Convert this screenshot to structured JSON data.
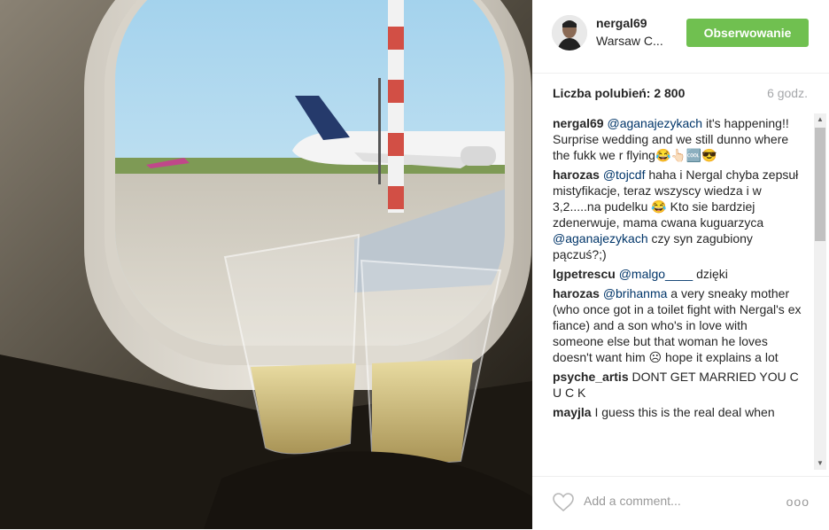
{
  "header": {
    "username": "nergal69",
    "location": "Warsaw C...",
    "follow_label": "Obserwowanie"
  },
  "stats": {
    "likes": "Liczba polubień: 2 800",
    "time": "6 godz."
  },
  "comments": [
    {
      "user": "nergal69",
      "mention": "@aganajezykach",
      "text": " it's happening!! Surprise wedding and we still dunno where the fukk we r flying😂👆🏻🆒😎"
    },
    {
      "user": "harozas",
      "mention": "@tojcdf",
      "text": " haha i Nergal chyba zepsuł mistyfikacje, teraz wszyscy wiedza i w 3,2.....na pudelku 😂 Kto sie bardziej zdenerwuje, mama cwana kuguarzyca ",
      "mention2": "@aganajezykach",
      "text2": " czy syn zagubiony pączuś?;)"
    },
    {
      "user": "lgpetrescu",
      "mention": "@malgo____",
      "text": " dzięki"
    },
    {
      "user": "harozas",
      "mention": "@brihanma",
      "text": " a very sneaky mother (who once got in a toilet fight with Nergal's ex fiance) and a son who's in love with someone else but that woman he loves doesn't want him ☹ hope it explains a lot"
    },
    {
      "user": "psyche_artis",
      "mention": "",
      "text": " DONT GET MARRIED YOU C U C K"
    },
    {
      "user": "mayjla",
      "mention": "",
      "text": " I guess this is the real deal when"
    }
  ],
  "footer": {
    "add_comment_placeholder": "Add a comment...",
    "more_label": "ooo"
  },
  "icons": {
    "like": "heart-icon",
    "scroll_up": "arrow-up-icon",
    "scroll_down": "arrow-down-icon"
  },
  "colors": {
    "follow_button": "#70c050",
    "mention": "#003569",
    "muted": "#a5a7aa"
  }
}
